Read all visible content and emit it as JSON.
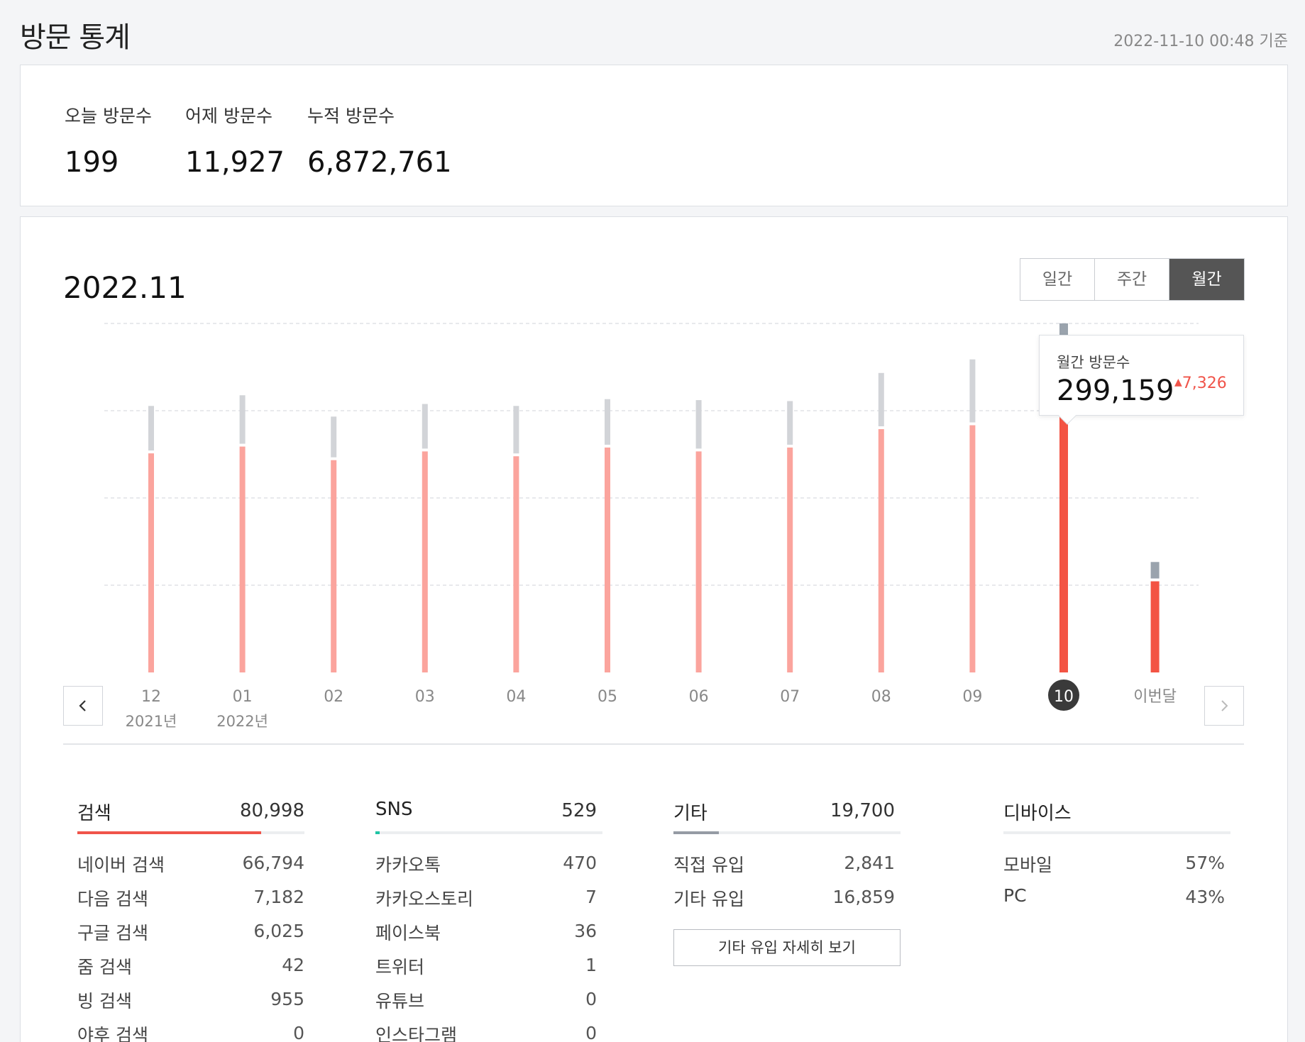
{
  "header": {
    "title": "방문 통계",
    "timestamp": "2022-11-10 00:48 기준"
  },
  "summary": [
    {
      "label": "오늘 방문수",
      "value": "199"
    },
    {
      "label": "어제 방문수",
      "value": "11,927"
    },
    {
      "label": "누적 방문수",
      "value": "6,872,761"
    }
  ],
  "period": "2022.11",
  "tabs": {
    "daily": "일간",
    "weekly": "주간",
    "monthly": "월간",
    "active": "monthly"
  },
  "tooltip": {
    "label": "월간 방문수",
    "value": "299,159",
    "diff": "7,326",
    "diff_direction": "up"
  },
  "chart_data": {
    "type": "bar",
    "categories": [
      "12",
      "01",
      "02",
      "03",
      "04",
      "05",
      "06",
      "07",
      "08",
      "09",
      "10",
      "이번달"
    ],
    "year_labels": [
      "2021년",
      "2022년",
      "",
      "",
      "",
      "",
      "",
      "",
      "",
      "",
      "",
      ""
    ],
    "series": [
      {
        "values": [
          226000,
          233000,
          219000,
          228000,
          223000,
          232000,
          228000,
          232000,
          251000,
          255000,
          299159,
          94000
        ]
      },
      {
        "values": [
          46000,
          50000,
          42000,
          46000,
          49000,
          47000,
          50000,
          45000,
          55000,
          65000,
          58000,
          17000
        ]
      }
    ],
    "selected_index": 10,
    "ylim": [
      0,
      360000
    ],
    "grid": true,
    "colors": {
      "base": "#fba49d",
      "base_selected": "#f35444",
      "top": "#d2d4d8",
      "top_selected": "#9aa3ad"
    }
  },
  "sections": {
    "search": {
      "title": "검색",
      "total": "80,998",
      "share": 0.81,
      "color": "#f0544a",
      "rows": [
        {
          "k": "네이버 검색",
          "v": "66,794"
        },
        {
          "k": "다음 검색",
          "v": "7,182"
        },
        {
          "k": "구글 검색",
          "v": "6,025"
        },
        {
          "k": "줌 검색",
          "v": "42"
        },
        {
          "k": "빙 검색",
          "v": "955"
        },
        {
          "k": "야후 검색",
          "v": "0"
        }
      ]
    },
    "sns": {
      "title": "SNS",
      "total": "529",
      "share": 0.02,
      "color": "#1fc4a4",
      "rows": [
        {
          "k": "카카오톡",
          "v": "470"
        },
        {
          "k": "카카오스토리",
          "v": "7"
        },
        {
          "k": "페이스북",
          "v": "36"
        },
        {
          "k": "트위터",
          "v": "1"
        },
        {
          "k": "유튜브",
          "v": "0"
        },
        {
          "k": "인스타그램",
          "v": "0"
        }
      ]
    },
    "etc": {
      "title": "기타",
      "total": "19,700",
      "share": 0.2,
      "color": "#959ba4",
      "rows": [
        {
          "k": "직접 유입",
          "v": "2,841"
        },
        {
          "k": "기타 유입",
          "v": "16,859"
        }
      ],
      "button": "기타 유입 자세히 보기"
    },
    "device": {
      "title": "디바이스",
      "rows": [
        {
          "k": "모바일",
          "v": "57%"
        },
        {
          "k": "PC",
          "v": "43%"
        }
      ]
    }
  }
}
